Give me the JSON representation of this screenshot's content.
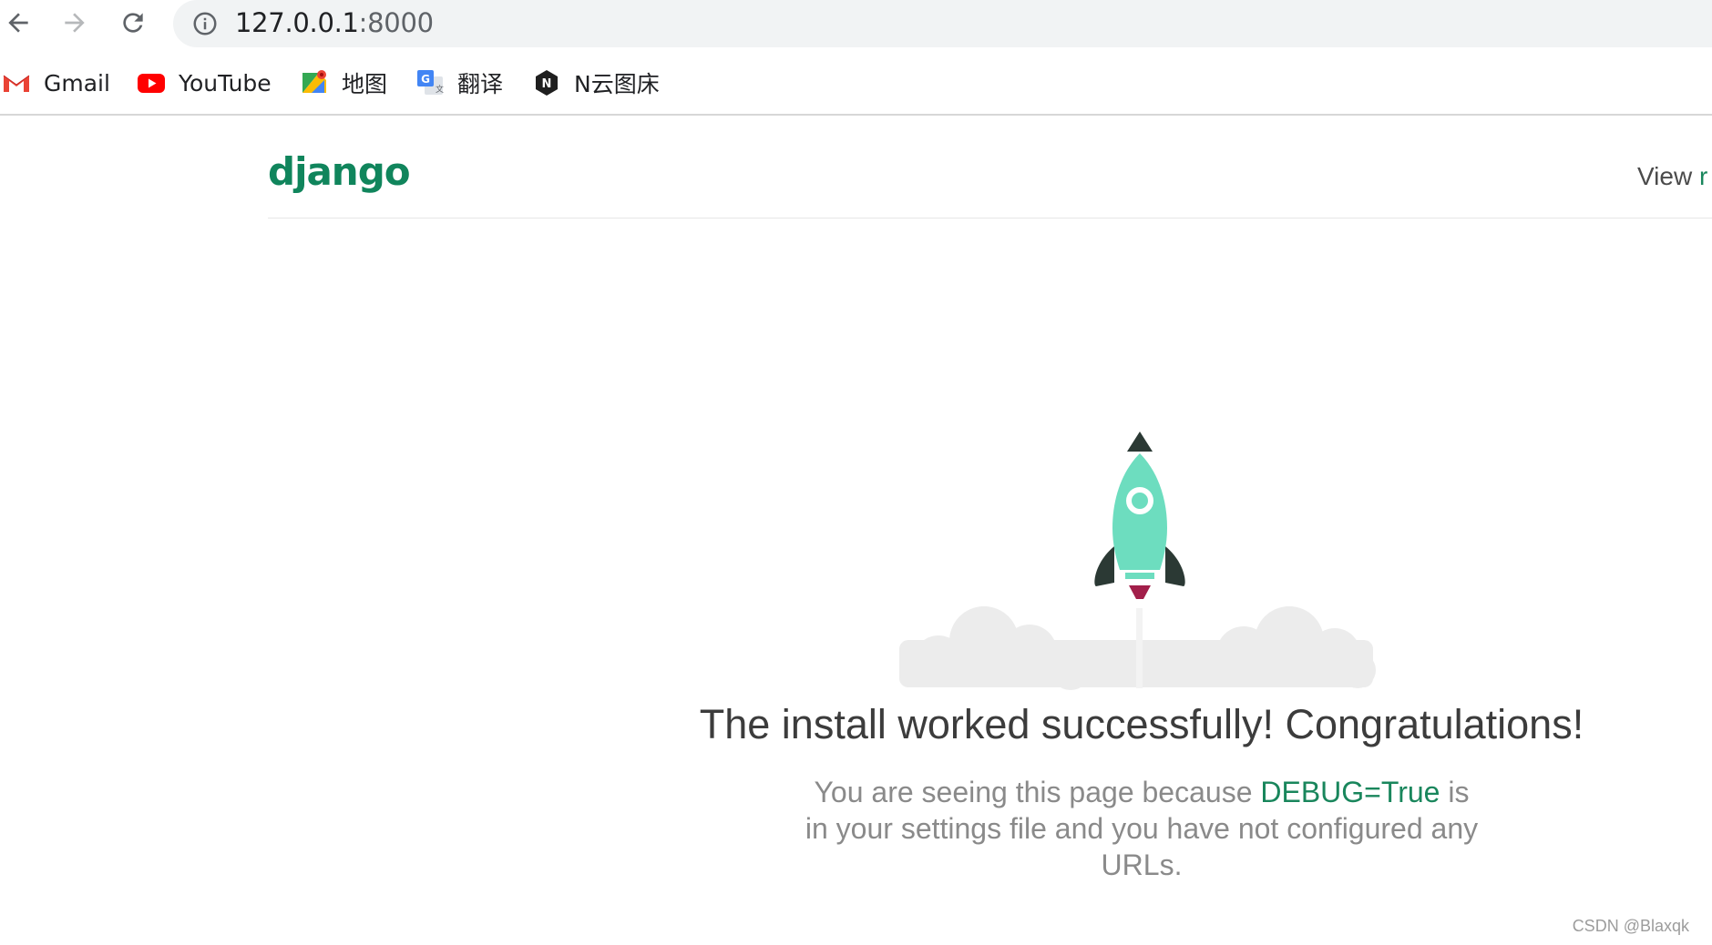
{
  "browser": {
    "nav": {
      "back_icon": "arrow-left-icon",
      "forward_icon": "arrow-right-icon",
      "reload_icon": "reload-icon"
    },
    "omnibox": {
      "icon": "info-circle-icon",
      "url_host": "127.0.0.1",
      "url_port": ":8000"
    },
    "bookmarks": [
      {
        "label": "Gmail",
        "icon": "gmail-icon"
      },
      {
        "label": "YouTube",
        "icon": "youtube-icon"
      },
      {
        "label": "地图",
        "icon": "maps-icon"
      },
      {
        "label": "翻译",
        "icon": "translate-icon"
      },
      {
        "label": "N云图床",
        "icon": "nyun-icon"
      }
    ]
  },
  "page": {
    "logo": "django",
    "release_prefix": "View ",
    "release_link": "r",
    "rocket_icon": "rocket-icon",
    "title": "The install worked successfully! Congratulations!",
    "desc_prefix": "You are seeing this page because ",
    "desc_debug": "DEBUG=True",
    "desc_suffix": " is in your settings file and you have not configured any URLs."
  },
  "watermark": "CSDN @Blaxqk",
  "colors": {
    "django_green": "#19865c",
    "rocket_body": "#6dddbf",
    "rocket_dark": "#2b3934",
    "flame": "#a21f4a",
    "cloud": "#ececec"
  }
}
